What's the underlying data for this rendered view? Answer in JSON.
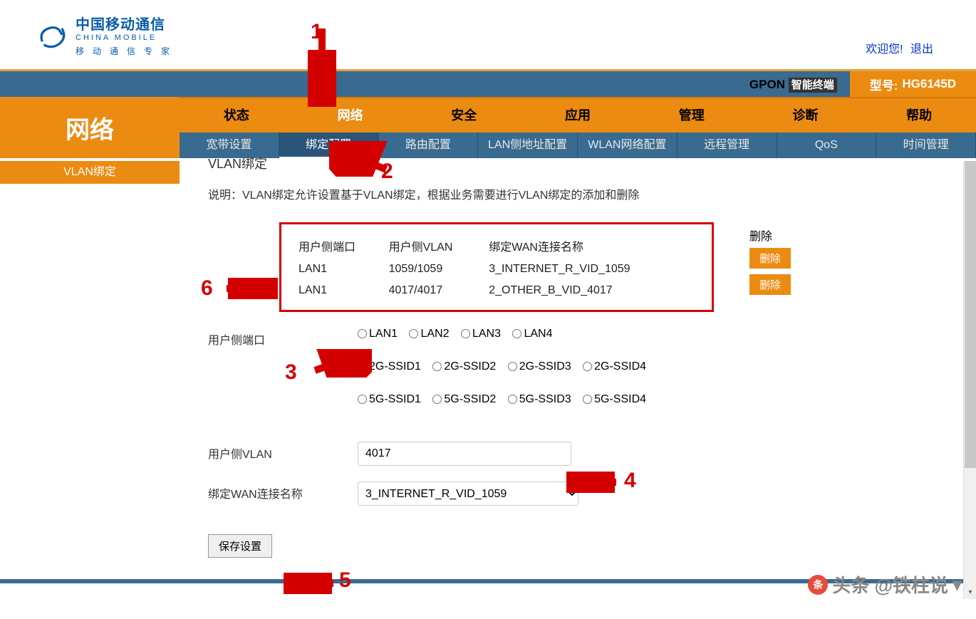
{
  "header": {
    "logo_cn": "中国移动通信",
    "logo_en": "CHINA MOBILE",
    "logo_sub": "移动通信专家",
    "welcome": "欢迎您!",
    "logout": "退出"
  },
  "bar2": {
    "gpon": "GPON",
    "term": "智能终端",
    "model_label": "型号:",
    "model_value": "HG6145D"
  },
  "nav": {
    "title": "网络",
    "tabs": [
      "状态",
      "网络",
      "安全",
      "应用",
      "管理",
      "诊断",
      "帮助"
    ],
    "active_tab": 1
  },
  "subtabs": {
    "items": [
      "宽带设置",
      "绑定配置",
      "路由配置",
      "LAN侧地址配置",
      "WLAN网络配置",
      "远程管理",
      "QoS",
      "时间管理"
    ],
    "active": 1
  },
  "sidebar": {
    "items": [
      "VLAN绑定"
    ]
  },
  "page": {
    "title": "VLAN绑定",
    "desc": "说明：VLAN绑定允许设置基于VLAN绑定，根据业务需要进行VLAN绑定的添加和删除",
    "table": {
      "headers": [
        "用户侧端口",
        "用户侧VLAN",
        "绑定WAN连接名称"
      ],
      "del_header": "删除",
      "rows": [
        {
          "port": "LAN1",
          "vlan": "1059/1059",
          "wan": "3_INTERNET_R_VID_1059"
        },
        {
          "port": "LAN1",
          "vlan": "4017/4017",
          "wan": "2_OTHER_B_VID_4017"
        }
      ],
      "del_btn": "删除"
    },
    "form": {
      "port_label": "用户侧端口",
      "port_lan": [
        "LAN1",
        "LAN2",
        "LAN3",
        "LAN4"
      ],
      "port_2g": [
        "2G-SSID1",
        "2G-SSID2",
        "2G-SSID3",
        "2G-SSID4"
      ],
      "port_5g": [
        "5G-SSID1",
        "5G-SSID2",
        "5G-SSID3",
        "5G-SSID4"
      ],
      "vlan_label": "用户侧VLAN",
      "vlan_value": "4017",
      "wan_label": "绑定WAN连接名称",
      "wan_value": "3_INTERNET_R_VID_1059",
      "save": "保存设置"
    }
  },
  "annotations": {
    "n1": "1",
    "n2": "2",
    "n3": "3",
    "n4": "4",
    "n5": "5",
    "n6": "6"
  },
  "watermark": "头条 @铁柱说"
}
